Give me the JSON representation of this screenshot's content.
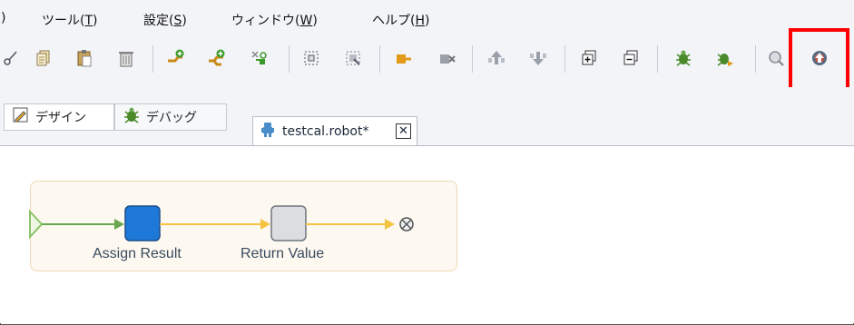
{
  "menu": {
    "partial": ")",
    "items": [
      {
        "label": "ツール(",
        "mnemonic": "T",
        "suffix": ")"
      },
      {
        "label": "設定(",
        "mnemonic": "S",
        "suffix": ")"
      },
      {
        "label": "ウィンドウ(",
        "mnemonic": "W",
        "suffix": ")"
      },
      {
        "label": "ヘルプ(",
        "mnemonic": "H",
        "suffix": ")"
      }
    ]
  },
  "toolbar": {
    "icons": [
      "cut-icon",
      "copy-icon",
      "paste-icon",
      "delete-icon",
      "add-step-icon",
      "add-branch-icon",
      "add-try-icon",
      "select-group-icon",
      "ungroup-icon",
      "insert-action-icon",
      "remove-action-icon",
      "move-up-icon",
      "move-down-icon",
      "expand-icon",
      "collapse-icon",
      "debug-run-icon",
      "debug-step-icon",
      "search-icon",
      "upload-robot-icon"
    ],
    "highlighted": "upload-robot-icon",
    "highlight_color": "#ff0000"
  },
  "perspectives": [
    {
      "label": "デザイン",
      "icon": "design-pencil-icon"
    },
    {
      "label": "デバッグ",
      "icon": "bug-icon"
    }
  ],
  "editor": {
    "tab_label": "testcal.robot*",
    "tab_icon": "robot-icon",
    "close_label": "✕"
  },
  "flow": {
    "steps": [
      {
        "label": "Assign Result",
        "color": "#1e78d8"
      },
      {
        "label": "Return Value",
        "color": "#dcdde0"
      }
    ],
    "arrow_color_done": "#6aa84f",
    "arrow_color_pending": "#f4c342",
    "end_icon": "end-node-icon"
  }
}
